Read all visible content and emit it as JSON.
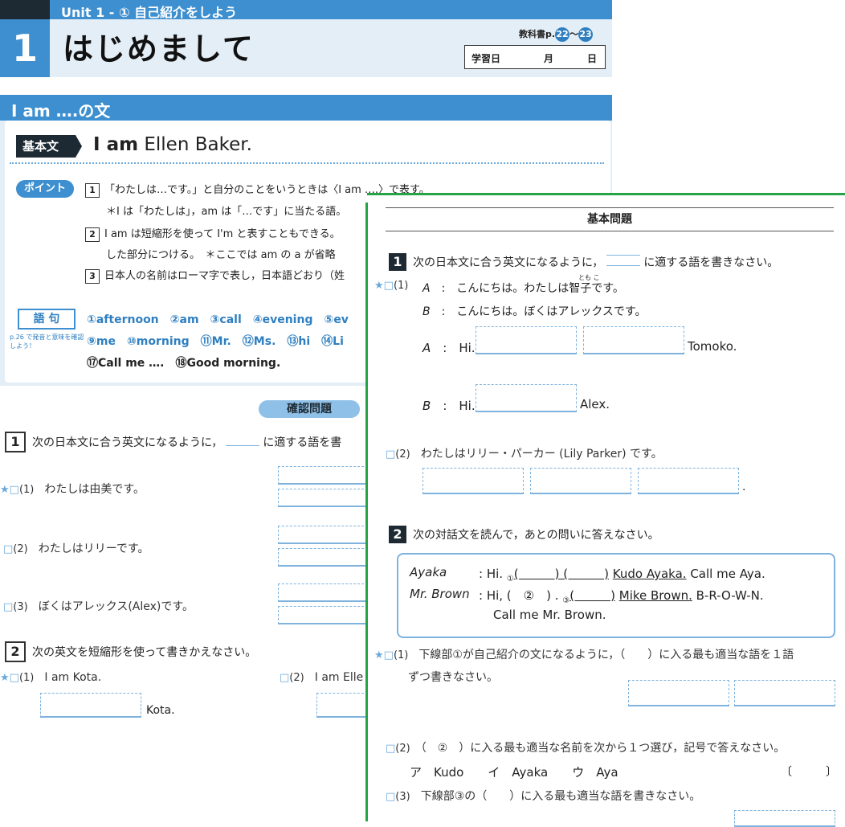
{
  "header": {
    "unit": "Unit 1 - ① 自己紹介をしよう",
    "lesson_number": "1",
    "lesson_title": "はじめまして",
    "textbook_label": "教科書p.",
    "page_from": "22",
    "tilde": "～",
    "page_to": "23",
    "study_date_label": "学習日",
    "month_label": "月",
    "day_label": "日"
  },
  "panel": {
    "title": "I am ….の文",
    "kihonbun_label": "基本文",
    "kihonbun_bold": "I am",
    "kihonbun_rest": " Ellen Baker.",
    "point_label": "ポイント",
    "points": [
      {
        "num": "1",
        "text": "「わたしは…です。」と自分のことをいうときは〈I am ….〉で表す。"
      },
      {
        "num": "",
        "text": "＊I は「わたしは」，am は「…です」に当たる語。"
      },
      {
        "num": "2",
        "text": "I am は短縮形を使って I'm と表すこともできる。"
      },
      {
        "num": "",
        "text": "した部分につける。　＊ここでは am の a が省略"
      },
      {
        "num": "3",
        "text": "日本人の名前はローマ字で表し，日本語どおり（姓"
      }
    ],
    "goku_label": "語 句",
    "goku_note": "p.26 で発音と意味を確認しよう！",
    "vocab_row1": "①afternoon　②am　③call　④evening　⑤ev",
    "vocab_row2": "⑨me　⑩morning　⑪Mr.　⑫Ms.　⑬hi　⑭Li",
    "vocab_row3": "⑰Call me ….　⑱Good morning."
  },
  "kakunin": {
    "title": "確認問題",
    "sec1_num": "1",
    "sec1_text": "次の日本文に合う英文になるように，",
    "sec1_text2": "に適する語を書",
    "q1": "わたしは由美です。",
    "q2": "わたしはリリーです。",
    "q3": "ぼくはアレックス(Alex)です。",
    "sec2_num": "2",
    "sec2_text": "次の英文を短縮形を使って書きかえなさい。",
    "q2_1": "I am Kota.",
    "q2_1_ans": "Kota.",
    "q2_2": "I am Elle",
    "n1": "(1)",
    "n2": "(2)",
    "n3": "(3)"
  },
  "kihon": {
    "title": "基本問題",
    "sec1_num": "1",
    "sec1_text": "次の日本文に合う英文になるように，",
    "sec1_text2": "に適する語を書きなさい。",
    "q1_A": "A",
    "q1_A_text": "こんにちは。わたしは智子です。",
    "ruby": "とも こ",
    "q1_B": "B",
    "q1_B_text": "こんにちは。ぼくはアレックスです。",
    "a_hi": "Hi.",
    "a_tomoko": "Tomoko.",
    "b_alex": "Alex.",
    "colon": ":",
    "q2": "わたしはリリー・パーカー (Lily Parker) です。",
    "period": ".",
    "sec2_num": "2",
    "sec2_text": "次の対話文を読んで，あとの問いに答えなさい。",
    "dialog": {
      "sp1": "Ayaka",
      "sp2": "Mr. Brown",
      "l1_a": ": Hi.",
      "l1_blank": "(　　　) (　　　)",
      "l1_ul": "Kudo Ayaka.",
      "l1_b": "Call me Aya.",
      "l2_a": ": Hi, (　②　) .",
      "l2_blank": "(　　　)",
      "l2_ul": "Mike Brown.",
      "l2_b": "B-R-O-W-N.",
      "l3": "Call me Mr. Brown.",
      "m1": "①",
      "m3": "③"
    },
    "s2_q1": "下線部①が自己紹介の文になるように，（　　）に入る最も適当な語を１語",
    "s2_q1b": "ずつ書きなさい。",
    "s2_q2": "（　②　）に入る最も適当な名前を次から１つ選び，記号で答えなさい。",
    "s2_choices": "ア　Kudo　　イ　Ayaka　　ウ　Aya",
    "s2_bracket": "〔　　　〕",
    "s2_q3": "下線部③の（　　）に入る最も適当な語を書きなさい。",
    "n1": "(1)",
    "n2": "(2)",
    "n3": "(3)"
  }
}
